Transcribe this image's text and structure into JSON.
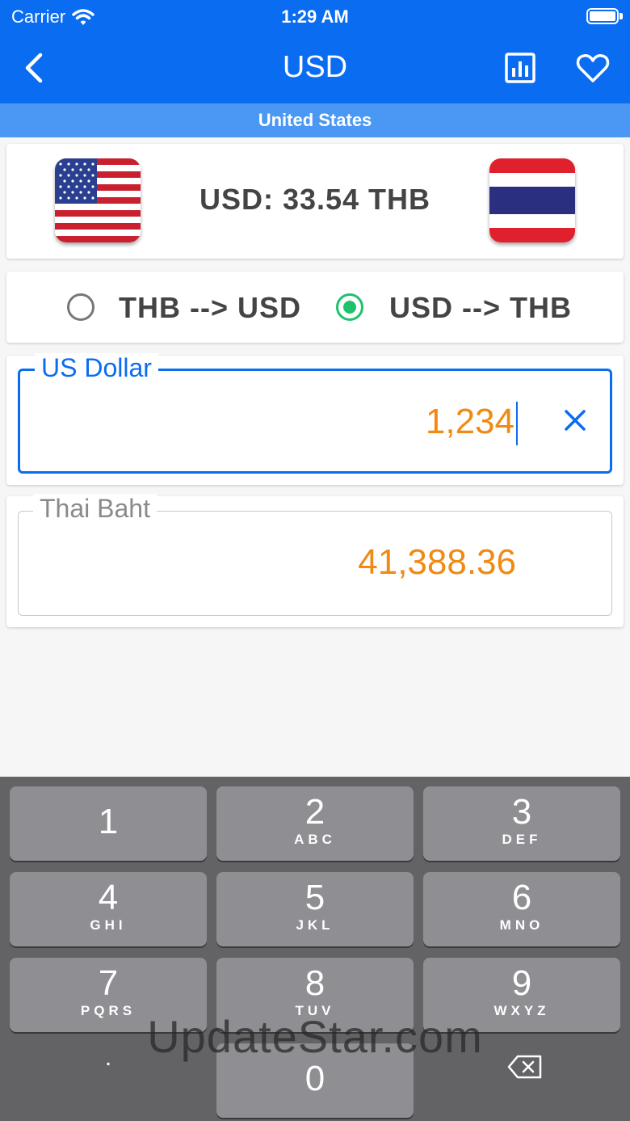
{
  "status_bar": {
    "carrier": "Carrier",
    "time": "1:29 AM"
  },
  "nav": {
    "title": "USD",
    "back_icon": "chevron-left-icon",
    "chart_icon": "bar-chart-icon",
    "favorite_icon": "heart-icon"
  },
  "subtitle": "United States",
  "rate_card": {
    "rate_text": "USD: 33.54 THB",
    "base_flag": "us-flag",
    "quote_flag": "thailand-flag"
  },
  "direction": {
    "options": [
      {
        "label": "THB --> USD",
        "selected": false
      },
      {
        "label": "USD --> THB",
        "selected": true
      }
    ]
  },
  "input": {
    "label": "US Dollar",
    "value": "1,234"
  },
  "output": {
    "label": "Thai Baht",
    "value": "41,388.36"
  },
  "keyboard": {
    "keys": [
      {
        "digit": "1",
        "letters": ""
      },
      {
        "digit": "2",
        "letters": "ABC"
      },
      {
        "digit": "3",
        "letters": "DEF"
      },
      {
        "digit": "4",
        "letters": "GHI"
      },
      {
        "digit": "5",
        "letters": "JKL"
      },
      {
        "digit": "6",
        "letters": "MNO"
      },
      {
        "digit": "7",
        "letters": "PQRS"
      },
      {
        "digit": "8",
        "letters": "TUV"
      },
      {
        "digit": "9",
        "letters": "WXYZ"
      }
    ],
    "dot": ".",
    "zero": "0"
  },
  "watermark": "UpdateStar.com",
  "colors": {
    "primary": "#0a6cf0",
    "subtitle_bar": "#4a98f4",
    "value": "#f08a12",
    "radio_selected": "#1ec26b"
  }
}
